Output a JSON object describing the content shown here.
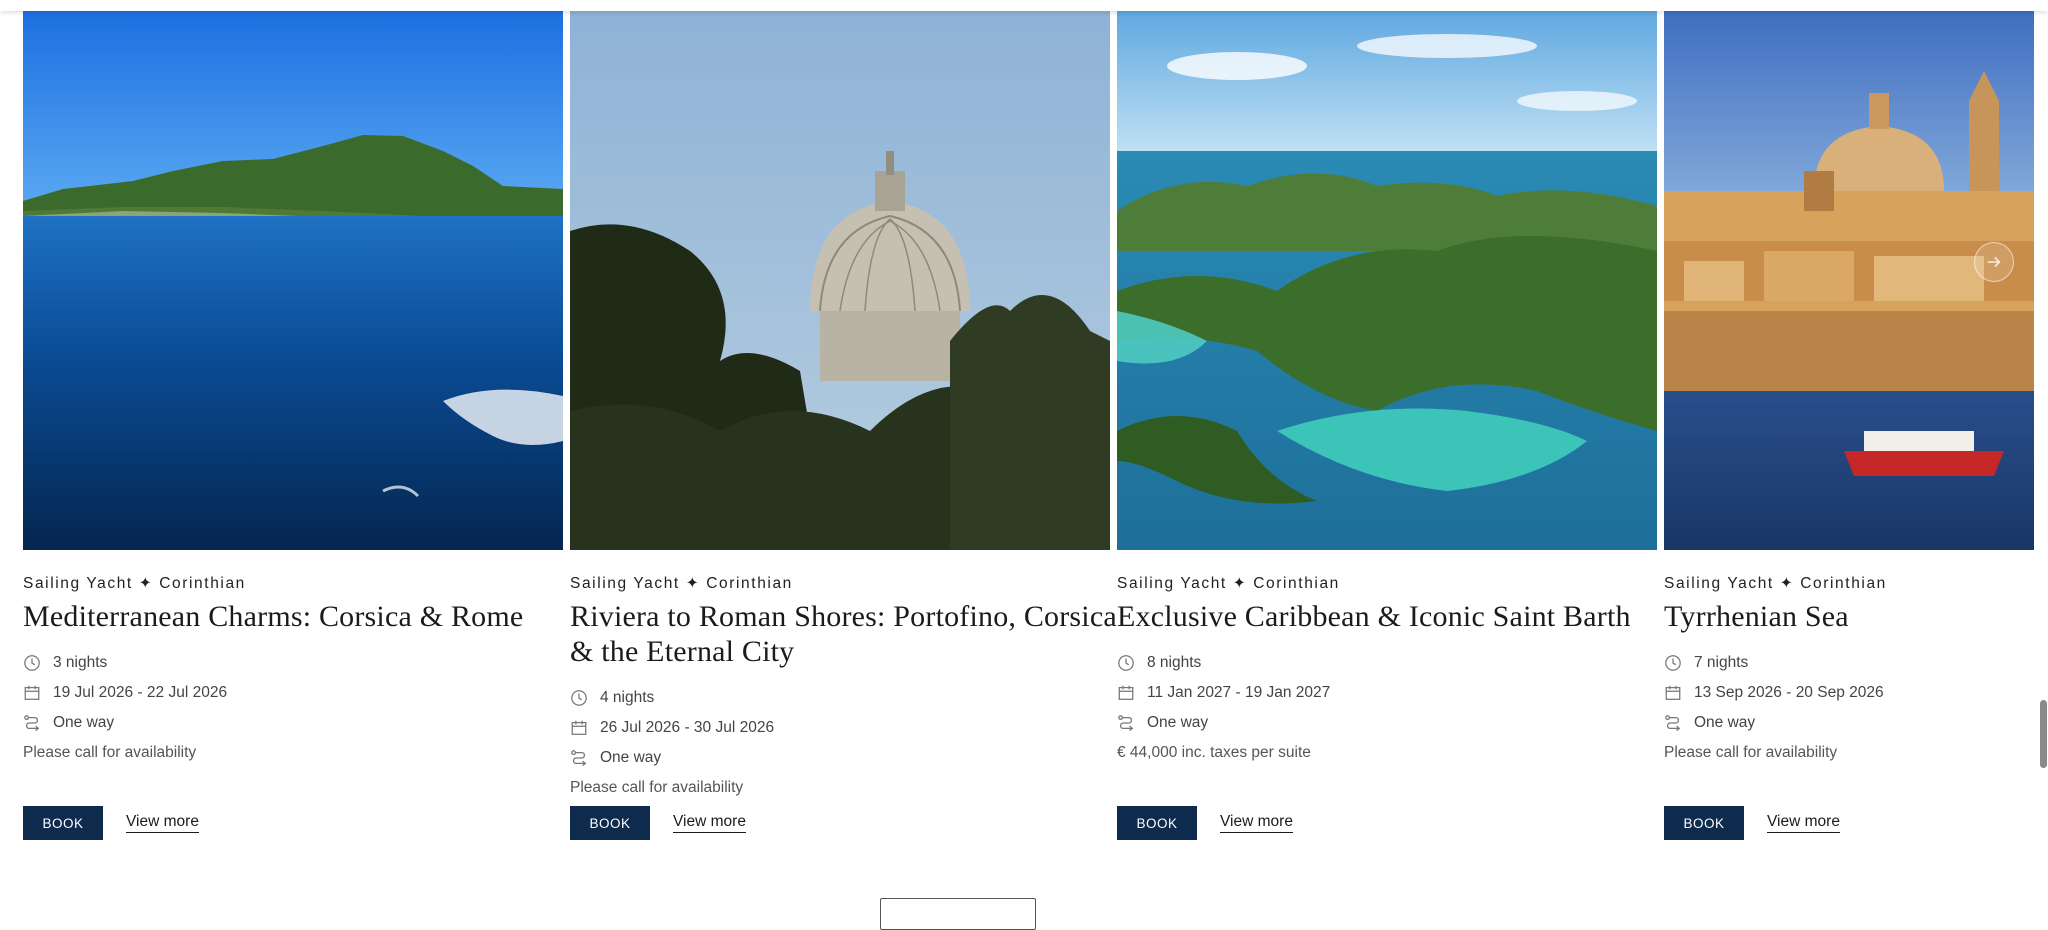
{
  "colors": {
    "accent": "#0e2a4d",
    "text": "#1b1b1b",
    "muted": "#555555"
  },
  "cards": [
    {
      "ship": "Sailing Yacht ✦ Corinthian",
      "title": "Mediterranean Charms: Corsica & Rome",
      "nights": "3 nights",
      "dates": "19 Jul 2026 - 22 Jul 2026",
      "route": "One way",
      "price": "Please call for availability",
      "book_label": "BOOK",
      "view_label": "View more"
    },
    {
      "ship": "Sailing Yacht ✦ Corinthian",
      "title": "Riviera to Roman Shores: Portofino, Corsica & the Eternal City",
      "nights": "4 nights",
      "dates": "26 Jul 2026 - 30 Jul 2026",
      "route": "One way",
      "price": "Please call for availability",
      "book_label": "BOOK",
      "view_label": "View more"
    },
    {
      "ship": "Sailing Yacht ✦ Corinthian",
      "title": "Exclusive Caribbean & Iconic Saint Barth",
      "nights": "8 nights",
      "dates": "11 Jan 2027 - 19 Jan 2027",
      "route": "One way",
      "price": "€ 44,000 inc. taxes per suite",
      "book_label": "BOOK",
      "view_label": "View more"
    },
    {
      "ship": "Sailing Yacht ✦ Corinthian",
      "title": "Tyrrhenian Sea",
      "nights": "7 nights",
      "dates": "13 Sep 2026 - 20 Sep 2026",
      "route": "One way",
      "price": "Please call for availability",
      "book_label": "BOOK",
      "view_label": "View more"
    }
  ],
  "icons": {
    "duration": "clock-icon",
    "dates": "calendar-icon",
    "route": "route-icon",
    "carousel_next": "arrow-right-icon"
  }
}
